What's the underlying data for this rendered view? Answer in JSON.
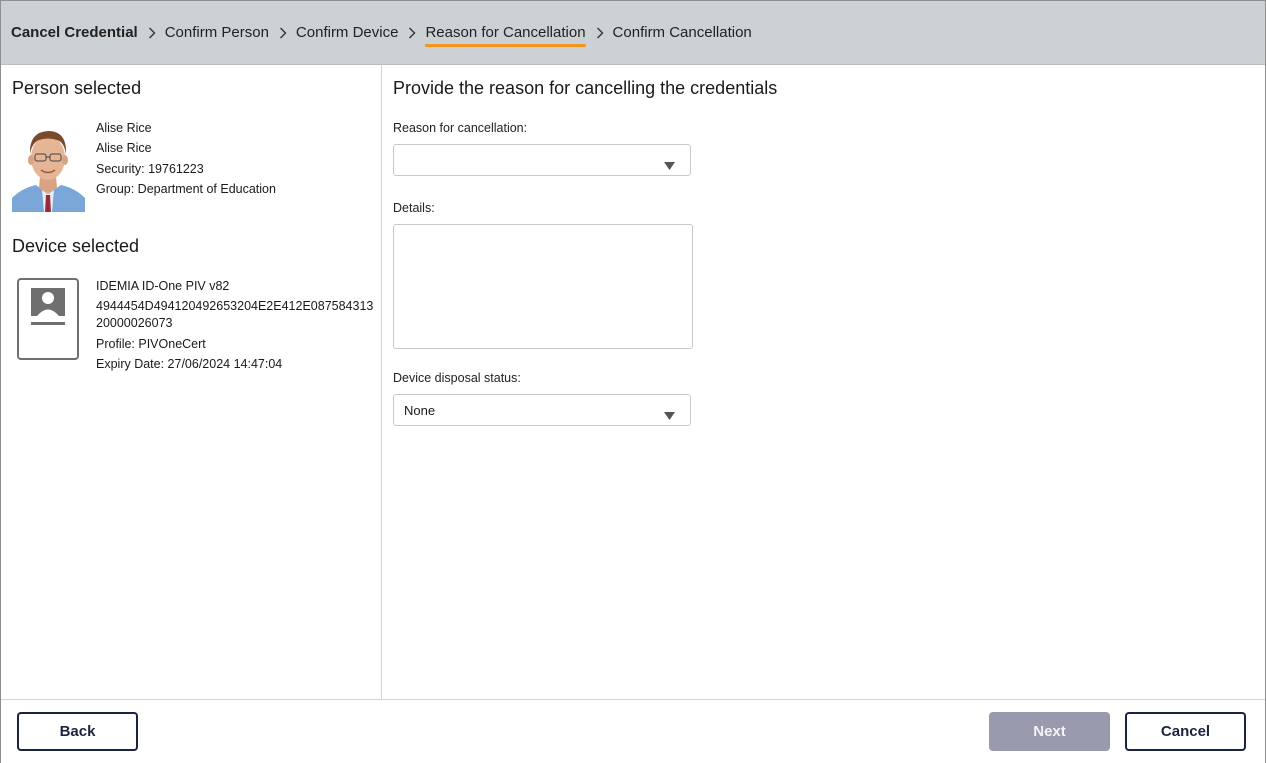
{
  "breadcrumb": {
    "items": [
      {
        "label": "Cancel Credential"
      },
      {
        "label": "Confirm Person"
      },
      {
        "label": "Confirm Device"
      },
      {
        "label": "Reason for Cancellation"
      },
      {
        "label": "Confirm Cancellation"
      }
    ],
    "active_index": 3,
    "accent_color": "#f5931f"
  },
  "person": {
    "section_title": "Person selected",
    "name": "Alise Rice",
    "display_name": "Alise Rice",
    "security": "Security:  19761223",
    "group": "Group:  Department of Education",
    "photo_icon": "person-photo"
  },
  "device": {
    "section_title": "Device selected",
    "model": "IDEMIA ID-One PIV v82",
    "serial_line1": "4944454D494120492653204E2E412E087584313",
    "serial_line2": "20000026073",
    "profile": "Profile:  PIVOneCert",
    "expiry": "Expiry Date:  27/06/2024 14:47:04",
    "icon": "id-card-icon"
  },
  "form": {
    "title": "Provide the reason for cancelling the credentials",
    "reason_label": "Reason for cancellation:",
    "reason_value": "",
    "details_label": "Details:",
    "details_value": "",
    "disposal_label": "Device disposal status:",
    "disposal_value": "None"
  },
  "footer": {
    "back_label": "Back",
    "next_label": "Next",
    "cancel_label": "Cancel",
    "next_enabled": false
  }
}
